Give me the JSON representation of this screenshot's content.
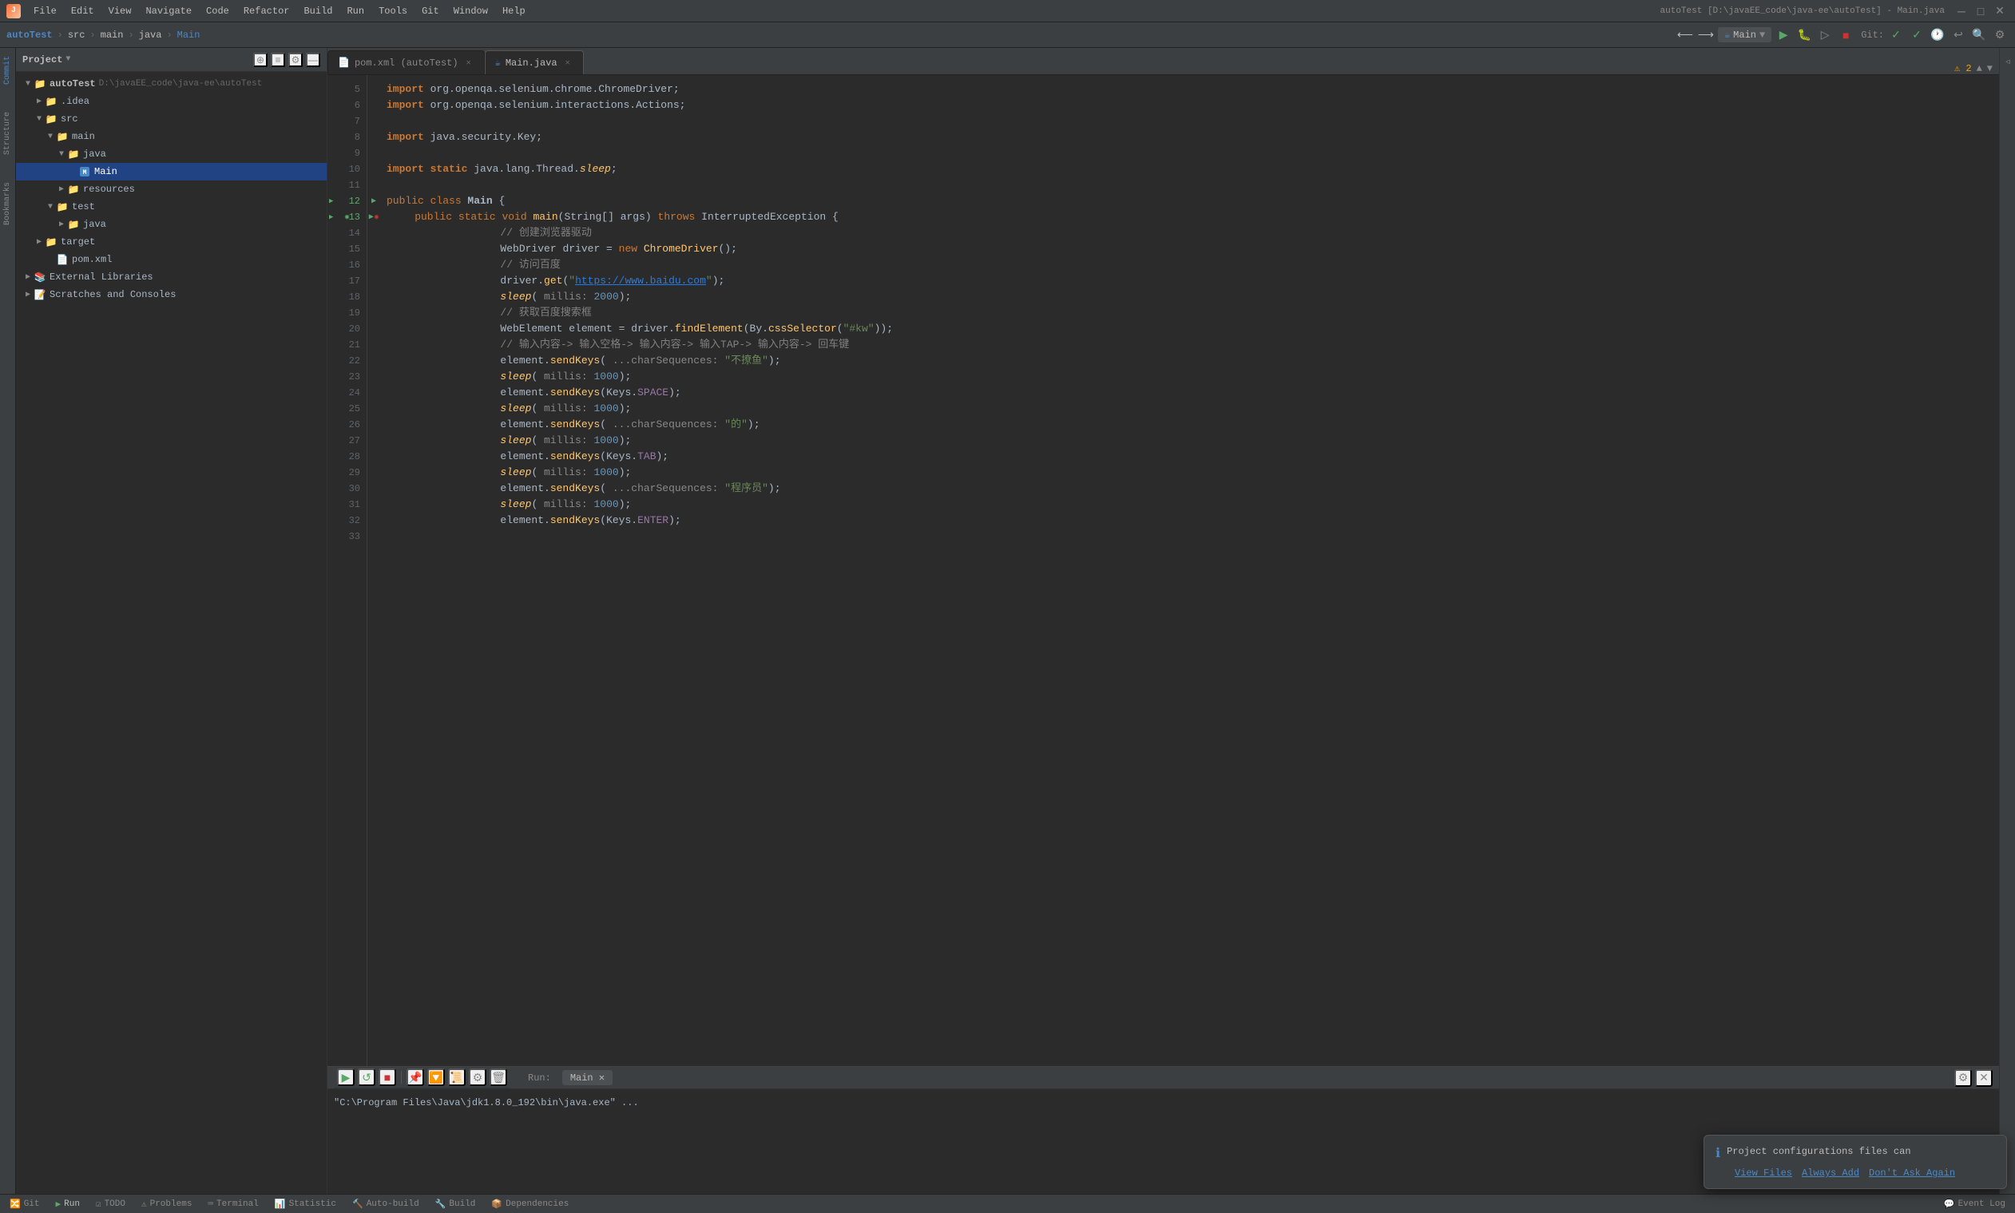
{
  "app": {
    "title": "autoTest [D:\\javaEE_code\\java-ee\\autoTest] - Main.java",
    "logo_text": "J"
  },
  "menu": {
    "items": [
      "File",
      "Edit",
      "View",
      "Navigate",
      "Code",
      "Refactor",
      "Build",
      "Run",
      "Tools",
      "Git",
      "Window",
      "Help"
    ]
  },
  "toolbar": {
    "project_name": "autoTest",
    "breadcrumbs": [
      "src",
      "main",
      "java",
      "Main"
    ],
    "run_config": "Main",
    "vcs_label": "Git:"
  },
  "tabs": [
    {
      "label": "pom.xml (autoTest)",
      "active": false,
      "icon": "📄"
    },
    {
      "label": "Main.java",
      "active": true,
      "icon": "☕"
    }
  ],
  "project_panel": {
    "title": "Project",
    "tree": [
      {
        "indent": 0,
        "label": "autoTest",
        "path": "D:\\javaEE_code\\java-ee\\autoTest",
        "type": "project",
        "expanded": true,
        "icon": "📁"
      },
      {
        "indent": 1,
        "label": ".idea",
        "type": "folder",
        "expanded": false,
        "icon": "📁"
      },
      {
        "indent": 1,
        "label": "src",
        "type": "folder",
        "expanded": true,
        "icon": "📁"
      },
      {
        "indent": 2,
        "label": "main",
        "type": "folder",
        "expanded": true,
        "icon": "📁"
      },
      {
        "indent": 3,
        "label": "java",
        "type": "folder",
        "expanded": true,
        "icon": "📁",
        "color": "blue"
      },
      {
        "indent": 4,
        "label": "Main",
        "type": "java",
        "expanded": false,
        "icon": "☕",
        "selected": true
      },
      {
        "indent": 3,
        "label": "resources",
        "type": "folder",
        "expanded": false,
        "icon": "📁"
      },
      {
        "indent": 2,
        "label": "test",
        "type": "folder",
        "expanded": true,
        "icon": "📁"
      },
      {
        "indent": 3,
        "label": "java",
        "type": "folder",
        "expanded": false,
        "icon": "📁",
        "color": "green"
      },
      {
        "indent": 1,
        "label": "target",
        "type": "folder",
        "expanded": false,
        "icon": "📁"
      },
      {
        "indent": 2,
        "label": "pom.xml",
        "type": "xml",
        "icon": "📄"
      },
      {
        "indent": 0,
        "label": "External Libraries",
        "type": "folder",
        "expanded": false,
        "icon": "📚"
      },
      {
        "indent": 0,
        "label": "Scratches and Consoles",
        "type": "folder",
        "expanded": false,
        "icon": "📝"
      }
    ]
  },
  "code": {
    "lines": [
      {
        "num": 5,
        "content": "import org.openqa.selenium.chrome.ChromeDriver;",
        "type": "import"
      },
      {
        "num": 6,
        "content": "import org.openqa.selenium.interactions.Actions;",
        "type": "import"
      },
      {
        "num": 7,
        "content": "",
        "type": "blank"
      },
      {
        "num": 8,
        "content": "import java.security.Key;",
        "type": "import"
      },
      {
        "num": 9,
        "content": "",
        "type": "blank"
      },
      {
        "num": 10,
        "content": "import static java.lang.Thread.sleep;",
        "type": "import"
      },
      {
        "num": 11,
        "content": "",
        "type": "blank"
      },
      {
        "num": 12,
        "content": "public class Main {",
        "type": "class",
        "arrow": true
      },
      {
        "num": 13,
        "content": "    public static void main(String[] args) throws InterruptedException {",
        "type": "method",
        "arrow": true,
        "debug": true
      },
      {
        "num": 14,
        "content": "        // 创建浏览器驱动",
        "type": "comment"
      },
      {
        "num": 15,
        "content": "        WebDriver driver = new ChromeDriver();",
        "type": "code"
      },
      {
        "num": 16,
        "content": "        // 访问百度",
        "type": "comment"
      },
      {
        "num": 17,
        "content": "        driver.get(\"https://www.baidu.com\");",
        "type": "code"
      },
      {
        "num": 18,
        "content": "        sleep( millis: 2000);",
        "type": "code"
      },
      {
        "num": 19,
        "content": "        // 获取百度搜索框",
        "type": "comment"
      },
      {
        "num": 20,
        "content": "        WebElement element = driver.findElement(By.cssSelector(\"#kw\"));",
        "type": "code"
      },
      {
        "num": 21,
        "content": "        // 输入内容-> 输入空格-> 输入内容-> 输入TAP-> 输入内容-> 回车键",
        "type": "comment"
      },
      {
        "num": 22,
        "content": "        element.sendKeys( ...charSequences: \"不撩鱼\");",
        "type": "code"
      },
      {
        "num": 23,
        "content": "        sleep( millis: 1000);",
        "type": "code"
      },
      {
        "num": 24,
        "content": "        element.sendKeys(Keys.SPACE);",
        "type": "code"
      },
      {
        "num": 25,
        "content": "        sleep( millis: 1000);",
        "type": "code"
      },
      {
        "num": 26,
        "content": "        element.sendKeys( ...charSequences: \"的\");",
        "type": "code"
      },
      {
        "num": 27,
        "content": "        sleep( millis: 1000);",
        "type": "code"
      },
      {
        "num": 28,
        "content": "        element.sendKeys(Keys.TAB);",
        "type": "code"
      },
      {
        "num": 29,
        "content": "        sleep( millis: 1000);",
        "type": "code"
      },
      {
        "num": 30,
        "content": "        element.sendKeys( ...charSequences: \"程序员\");",
        "type": "code"
      },
      {
        "num": 31,
        "content": "        sleep( millis: 1000);",
        "type": "code"
      },
      {
        "num": 32,
        "content": "        element.sendKeys(Keys.ENTER);",
        "type": "code"
      },
      {
        "num": 33,
        "content": "",
        "type": "blank"
      }
    ]
  },
  "bottom_panel": {
    "tabs": [
      "Run",
      "Main"
    ],
    "active_tab": "Main",
    "console_output": "\"C:\\Program Files\\Java\\jdk1.8.0_192\\bin\\java.exe\" ..."
  },
  "status_bar": {
    "items": [
      {
        "label": "Git",
        "icon": "🔀",
        "active": false
      },
      {
        "label": "Run",
        "icon": "▶",
        "active": true
      },
      {
        "label": "TODO",
        "icon": "☑",
        "active": false
      },
      {
        "label": "Problems",
        "icon": "⚠",
        "active": false
      },
      {
        "label": "Terminal",
        "icon": "⌨",
        "active": false
      },
      {
        "label": "Statistic",
        "icon": "📊",
        "active": false
      },
      {
        "label": "Auto-build",
        "icon": "🔨",
        "active": false
      },
      {
        "label": "Build",
        "icon": "🔧",
        "active": false
      },
      {
        "label": "Dependencies",
        "icon": "📦",
        "active": false
      }
    ],
    "right_items": [
      "Event Log"
    ]
  },
  "notification": {
    "text": "Project configurations files can",
    "actions": [
      "View Files",
      "Always Add",
      "Don't Ask Again"
    ]
  },
  "icons": {
    "arrow_right": "▶",
    "arrow_down": "▼",
    "close": "✕",
    "gear": "⚙",
    "info": "ℹ",
    "warning": "⚠",
    "error_count": "2"
  },
  "colors": {
    "accent_blue": "#4a88c7",
    "green": "#59a869",
    "red": "#cc3333",
    "orange": "#cc7832",
    "string": "#6a8759",
    "comment": "#808080",
    "number": "#6897bb"
  }
}
